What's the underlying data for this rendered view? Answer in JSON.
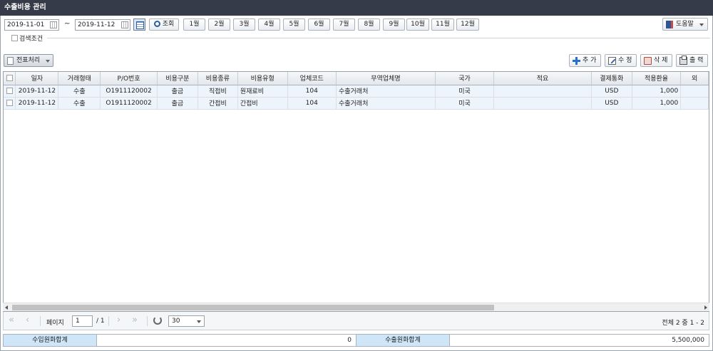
{
  "title": "수출비용 관리",
  "filters": {
    "date_from": "2019-11-01",
    "tilde": "~",
    "date_to": "2019-11-12",
    "search_label": "조회",
    "months": [
      "1월",
      "2월",
      "3월",
      "4월",
      "5월",
      "6월",
      "7월",
      "8월",
      "9월",
      "10월",
      "11월",
      "12월"
    ],
    "search_conditions_label": "검색조건",
    "help_label": "도움말"
  },
  "toolbar": {
    "slip_label": "전표처리",
    "add_label": "추 가",
    "edit_label": "수 정",
    "delete_label": "삭 제",
    "print_label": "출 력"
  },
  "grid": {
    "columns": [
      "일자",
      "거래형태",
      "P/O번호",
      "비용구분",
      "비용종류",
      "비용유형",
      "업체코드",
      "무역업체명",
      "국가",
      "적요",
      "결제통화",
      "적용환율",
      "외"
    ],
    "rows": [
      [
        "2019-11-12",
        "수출",
        "O1911120002",
        "출금",
        "직접비",
        "원재료비",
        "104",
        "수출거래처",
        "미국",
        "",
        "USD",
        "1,000",
        ""
      ],
      [
        "2019-11-12",
        "수출",
        "O1911120002",
        "출금",
        "간접비",
        "간접비",
        "104",
        "수출거래처",
        "미국",
        "",
        "USD",
        "1,000",
        ""
      ]
    ]
  },
  "pager": {
    "page_label": "페이지",
    "page_value": "1",
    "page_total": "/ 1",
    "page_size": "30",
    "total_text": "전체 2 중 1 - 2"
  },
  "totals": {
    "import_label": "수입원화합계",
    "import_value": "0",
    "export_label": "수출원화합계",
    "export_value": "5,500,000"
  }
}
